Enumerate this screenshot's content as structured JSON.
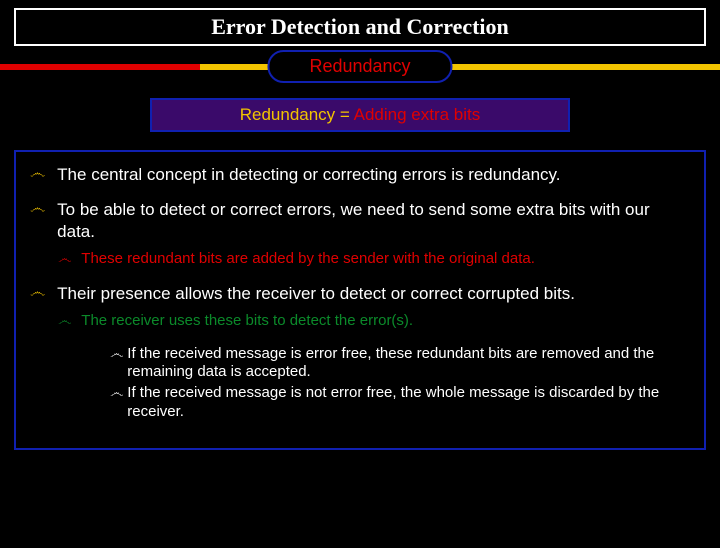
{
  "title": "Error Detection and Correction",
  "subtitle": "Redundancy",
  "equation": {
    "left": "Redundancy = ",
    "right": "Adding extra bits"
  },
  "bullets": {
    "b1": "The central concept in detecting or correcting errors is redundancy.",
    "b2": "To be able to detect or correct errors, we need to send some extra bits with our data.",
    "b2_1": "These redundant bits are added by the sender with the original data.",
    "b3": "Their presence allows the receiver to detect or correct corrupted bits.",
    "b3_1": "The receiver uses these bits to detect the error(s).",
    "b3_1_1": "If the received message is error free, these redundant bits are removed and the remaining data is accepted.",
    "b3_1_2": "If the received message is not error free, the whole message is discarded by the receiver."
  },
  "icons": {
    "swirl": "෴"
  }
}
